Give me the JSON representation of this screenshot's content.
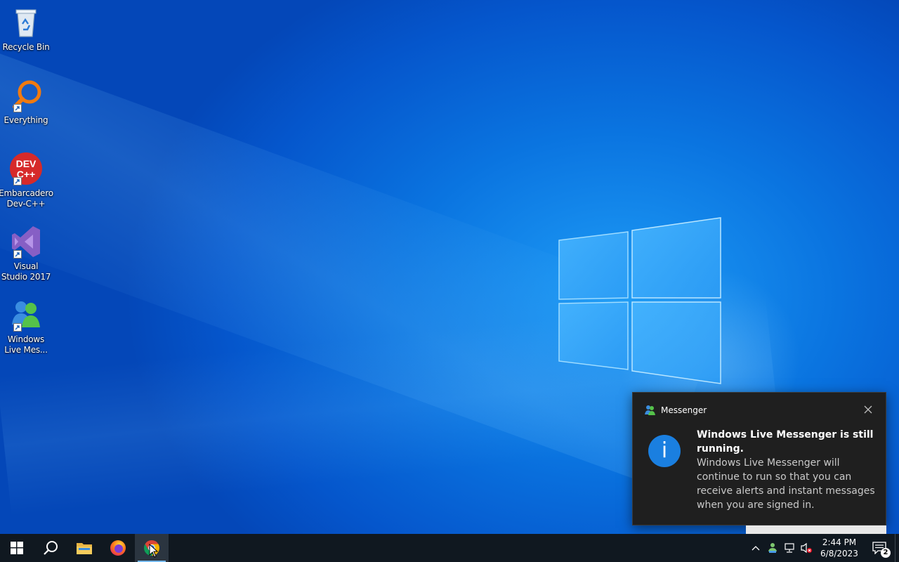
{
  "desktop": {
    "icons": [
      {
        "label": "Recycle Bin",
        "icon": "recycle-bin-icon"
      },
      {
        "label": "Everything",
        "icon": "everything-search-icon"
      },
      {
        "label": "Embarcadero Dev-C++",
        "icon": "devcpp-icon",
        "badge_text": "DEV C++"
      },
      {
        "label": "Visual Studio 2017",
        "icon": "visual-studio-icon"
      },
      {
        "label": "Windows Live Mes...",
        "icon": "windows-live-messenger-icon"
      }
    ]
  },
  "toast": {
    "app_name": "Messenger",
    "title": "Windows Live Messenger is still running.",
    "body": "Windows Live Messenger will continue to run so that you can receive alerts and instant messages when you are signed in.",
    "info_glyph": "i",
    "accent_color": "#1a7fe0"
  },
  "taskbar": {
    "items": [
      {
        "name": "start",
        "icon": "windows-start-icon"
      },
      {
        "name": "search",
        "icon": "search-icon"
      },
      {
        "name": "file-explorer",
        "icon": "folder-icon"
      },
      {
        "name": "firefox",
        "icon": "firefox-icon"
      },
      {
        "name": "chrome",
        "icon": "chrome-icon",
        "active": true
      }
    ],
    "tray": {
      "clock_time": "2:44 PM",
      "clock_date": "6/8/2023",
      "notification_count": "2",
      "icons": [
        "chevron-up-icon",
        "messenger-tray-icon",
        "network-icon",
        "volume-muted-icon"
      ]
    }
  }
}
